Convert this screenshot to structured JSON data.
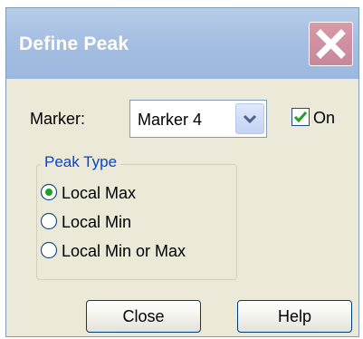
{
  "window": {
    "title": "Define Peak"
  },
  "marker": {
    "label": "Marker:",
    "selected": "Marker 4"
  },
  "on": {
    "label": "On",
    "checked": true
  },
  "peak_type": {
    "title": "Peak Type",
    "options": [
      {
        "label": "Local Max",
        "selected": true
      },
      {
        "label": "Local Min",
        "selected": false
      },
      {
        "label": "Local Min or Max",
        "selected": false
      }
    ]
  },
  "buttons": {
    "close": "Close",
    "help": "Help"
  },
  "icons": {
    "window_close": "close-x-icon",
    "dropdown": "chevron-down-icon",
    "checkbox": "checkmark-icon"
  },
  "colors": {
    "title_bar": "#a6bfe2",
    "close_button": "#c6889a",
    "dialog_face": "#ece9d8",
    "group_title": "#0046d5",
    "check_mark": "#21a121",
    "radio_selected": "#21a121"
  }
}
